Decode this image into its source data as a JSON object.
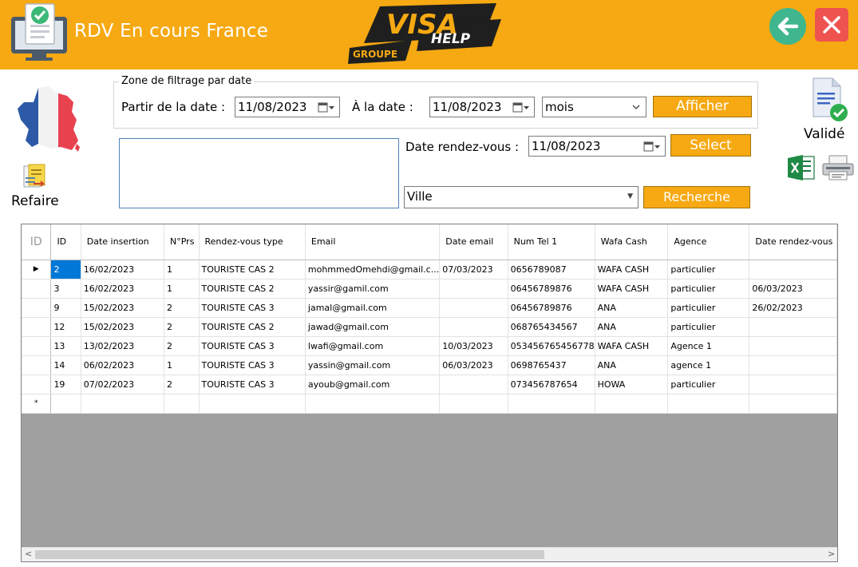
{
  "header": {
    "title": "RDV En cours France",
    "logo_text": [
      "VISA",
      "HELP",
      "GROUPE"
    ],
    "color": "#F6A912"
  },
  "actions": {
    "refaire_label": "Refaire",
    "valide_label": "Validé"
  },
  "filter": {
    "legend": "Zone de filtrage par date",
    "from_label": "Partir de la date :",
    "from_value": "11/08/2023",
    "to_label": "À  la date :",
    "to_value": "11/08/2023",
    "period_value": "mois",
    "afficher_label": "Afficher"
  },
  "rdv": {
    "label": "Date rendez-vous :",
    "value": "11/08/2023",
    "select_label": "Select"
  },
  "ville": {
    "value": "Ville",
    "recherche_label": "Recherche"
  },
  "grid": {
    "columns": [
      "ID",
      "ID",
      "Date insertion",
      "N°Prs",
      "Rendez-vous type",
      "Email",
      "Date email",
      "Num Tel 1",
      "Wafa Cash",
      "Agence",
      "Date rendez-vous"
    ],
    "rows": [
      [
        "2",
        "16/02/2023",
        "1",
        "TOURISTE CAS 2",
        "mohmmedOmehdi@gmail.c...",
        "07/03/2023",
        "0656789087",
        "WAFA CASH",
        "particulier",
        ""
      ],
      [
        "3",
        "16/02/2023",
        "1",
        "TOURISTE CAS 2",
        "yassir@gamil.com",
        "",
        "06456789876",
        "WAFA CASH",
        "particulier",
        "06/03/2023"
      ],
      [
        "9",
        "15/02/2023",
        "2",
        "TOURISTE CAS 3",
        "jamal@gmail.com",
        "",
        "06456789876",
        "ANA",
        "particulier",
        "26/02/2023"
      ],
      [
        "12",
        "15/02/2023",
        "2",
        "TOURISTE CAS 2",
        "jawad@gmail.com",
        "",
        "068765434567",
        "ANA",
        "particulier",
        ""
      ],
      [
        "13",
        "13/02/2023",
        "2",
        "TOURISTE CAS 3",
        "lwafi@gmail.com",
        "10/03/2023",
        "053456765456778",
        "WAFA CASH",
        "Agence 1",
        ""
      ],
      [
        "14",
        "06/02/2023",
        "1",
        "TOURISTE CAS 3",
        "yassin@gmail.com",
        "06/03/2023",
        "0698765437",
        "ANA",
        "agence 1",
        ""
      ],
      [
        "19",
        "07/02/2023",
        "2",
        "TOURISTE CAS 3",
        "ayoub@gmail.com",
        "",
        "073456787654",
        "HOWA",
        "particulier",
        ""
      ]
    ],
    "current_row_marker": "▶",
    "new_row_marker": "*"
  },
  "icons": [
    "computer-check-icon",
    "back-arrow-icon",
    "close-icon",
    "france-map-icon",
    "refresh-document-icon",
    "validated-document-icon",
    "excel-icon",
    "printer-icon",
    "calendar-dropdown-icon",
    "chevron-down-icon"
  ]
}
